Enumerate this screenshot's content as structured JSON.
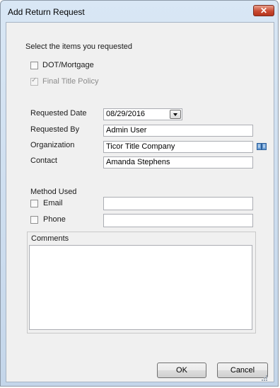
{
  "window": {
    "title": "Add Return Request",
    "close_glyph": "✕"
  },
  "items_section": {
    "heading": "Select the items you requested",
    "items": [
      {
        "label": "DOT/Mortgage",
        "checked": false,
        "enabled": true
      },
      {
        "label": "Final Title Policy",
        "checked": true,
        "enabled": false
      }
    ]
  },
  "form": {
    "requested_date_label": "Requested Date",
    "requested_date_value": "08/29/2016",
    "requested_by_label": "Requested By",
    "requested_by_value": "Admin User",
    "organization_label": "Organization",
    "organization_value": "Ticor Title Company",
    "contact_label": "Contact",
    "contact_value": "Amanda Stephens",
    "lookup_icon": "address-book-icon"
  },
  "method": {
    "heading": "Method Used",
    "email_label": "Email",
    "email_value": "",
    "phone_label": "Phone",
    "phone_value": ""
  },
  "comments": {
    "label": "Comments",
    "value": ""
  },
  "buttons": {
    "ok": "OK",
    "cancel": "Cancel"
  }
}
